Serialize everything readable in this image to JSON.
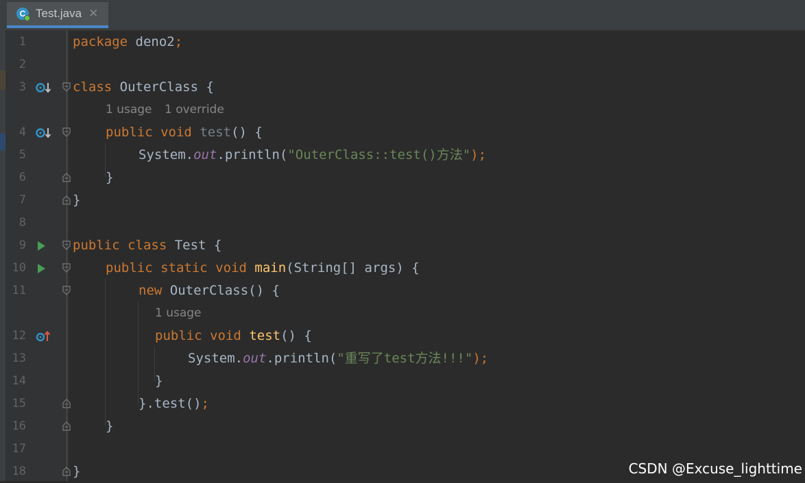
{
  "tab": {
    "title": "Test.java",
    "icon": "class-file-icon",
    "icon_letter": "C"
  },
  "lines": [
    {
      "n": "1"
    },
    {
      "n": "2"
    },
    {
      "n": "3"
    },
    {
      "n": "4"
    },
    {
      "n": "5"
    },
    {
      "n": "6"
    },
    {
      "n": "7"
    },
    {
      "n": "8"
    },
    {
      "n": "9"
    },
    {
      "n": "10"
    },
    {
      "n": "11"
    },
    {
      "n": "12"
    },
    {
      "n": "13"
    },
    {
      "n": "14"
    },
    {
      "n": "15"
    },
    {
      "n": "16"
    },
    {
      "n": "17"
    },
    {
      "n": "18"
    }
  ],
  "code": {
    "l1": [
      "package",
      " deno2",
      ";"
    ],
    "l3": [
      "class",
      " OuterClass {"
    ],
    "hint1": [
      "1 usage",
      "1 override"
    ],
    "l4": [
      "public",
      "void",
      "test",
      "() {"
    ],
    "l5": [
      "System.",
      "out",
      ".println(",
      "\"OuterClass::test()方法\"",
      ");"
    ],
    "l6": "}",
    "l7": "}",
    "l9": [
      "public",
      "class",
      " Test {"
    ],
    "l10": [
      "public",
      "static",
      "void",
      "main",
      "(String[] args) {"
    ],
    "l11": [
      "new",
      " OuterClass() {"
    ],
    "hint2": "1 usage",
    "l12": [
      "public",
      "void",
      "test",
      "() {"
    ],
    "l13": [
      "System.",
      "out",
      ".println(",
      "\"重写了test方法!!!\"",
      ");"
    ],
    "l14": "}",
    "l15": [
      "}.test()",
      ";"
    ],
    "l16": "}",
    "l18": "}"
  },
  "colors": {
    "keyword": "#cc7832",
    "function": "#ffc66d",
    "string": "#6a8759",
    "static_field": "#9876aa",
    "text": "#a9b7c6",
    "background": "#2b2b2b"
  },
  "watermark": "CSDN @Excuse_lighttime"
}
